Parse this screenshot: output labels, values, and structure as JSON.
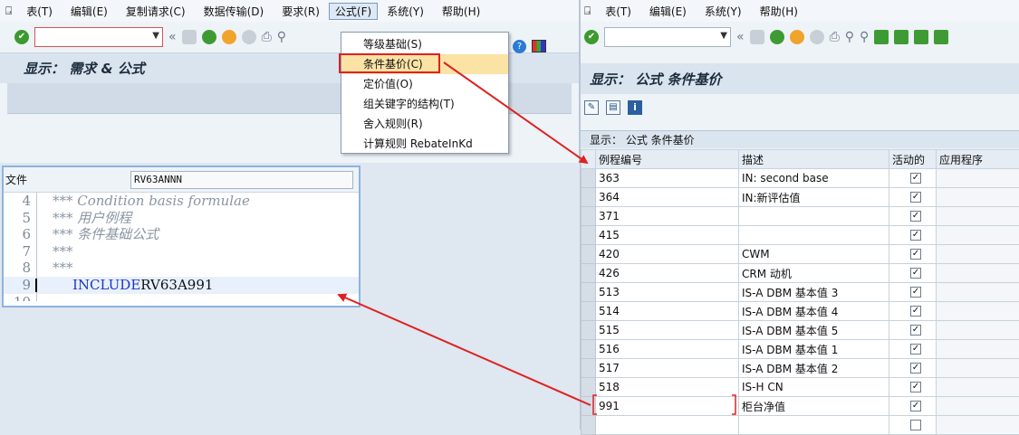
{
  "left_window": {
    "menu": [
      "表(T)",
      "编辑(E)",
      "复制请求(C)",
      "数据传输(D)",
      "要求(R)",
      "公式(F)",
      "系统(Y)",
      "帮助(H)"
    ],
    "active_menu_index": 5,
    "command_field_value": "",
    "title": "显示： 需求 & 公式"
  },
  "formula_menu": {
    "items": [
      "等级基础(S)",
      "条件基价(C)",
      "定价值(O)",
      "组关键字的结构(T)",
      "舍入规则(R)",
      "计算规则 RebateInKd"
    ],
    "highlighted_index": 1
  },
  "editor": {
    "file_label": "文件",
    "file_value": "RV63ANNN",
    "lines": [
      {
        "no": "4",
        "text": "*** Condition basis formulae",
        "type": "comment"
      },
      {
        "no": "5",
        "text": "*** 用户例程",
        "type": "comment"
      },
      {
        "no": "6",
        "text": "*** 条件基础公式",
        "type": "comment"
      },
      {
        "no": "7",
        "text": "***",
        "type": "comment"
      },
      {
        "no": "8",
        "text": "***",
        "type": "comment"
      },
      {
        "no": "9",
        "keyword": "INCLUDE",
        "text": " RV63A991",
        "type": "code"
      },
      {
        "no": "10",
        "text": "",
        "type": "comment"
      }
    ]
  },
  "right_window": {
    "menu": [
      "表(T)",
      "编辑(E)",
      "系统(Y)",
      "帮助(H)"
    ],
    "command_field_value": "",
    "title": "显示：  公式 条件基价",
    "grid_title": "显示：  公式 条件基价",
    "columns": [
      "例程编号",
      "描述",
      "活动的",
      "应用程序"
    ],
    "rows": [
      {
        "no": "363",
        "desc": "IN: second base",
        "active": true
      },
      {
        "no": "364",
        "desc": "IN:新评估值",
        "active": true
      },
      {
        "no": "371",
        "desc": "",
        "active": true
      },
      {
        "no": "415",
        "desc": "",
        "active": true
      },
      {
        "no": "420",
        "desc": "CWM",
        "active": true
      },
      {
        "no": "426",
        "desc": "CRM 动机",
        "active": true
      },
      {
        "no": "513",
        "desc": "IS-A DBM 基本值 3",
        "active": true
      },
      {
        "no": "514",
        "desc": "IS-A DBM 基本值 4",
        "active": true
      },
      {
        "no": "515",
        "desc": "IS-A DBM 基本值 5",
        "active": true
      },
      {
        "no": "516",
        "desc": "IS-A DBM 基本值 1",
        "active": true
      },
      {
        "no": "517",
        "desc": "IS-A DBM 基本值 2",
        "active": true
      },
      {
        "no": "518",
        "desc": "IS-H CN",
        "active": true
      },
      {
        "no": "991",
        "desc": "柜台净值",
        "active": true
      },
      {
        "no": "",
        "desc": "",
        "active": false
      }
    ]
  },
  "colors": {
    "annotation": "#e02020",
    "title_bg": "#dae4ef",
    "menu_highlight": "#fbe3a6"
  }
}
